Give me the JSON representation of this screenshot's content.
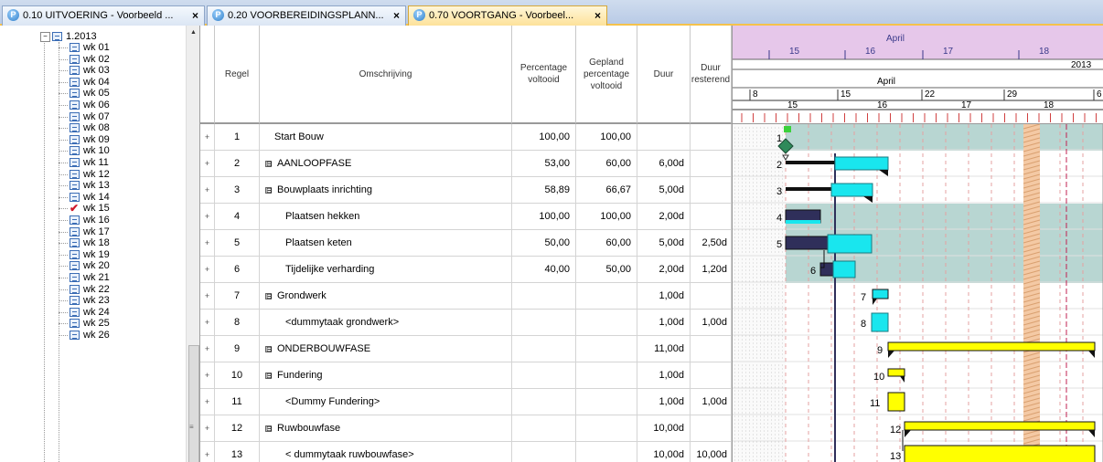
{
  "tabs": [
    {
      "label": "0.10 UITVOERING - Voorbeeld ...",
      "close": "×",
      "active": false
    },
    {
      "label": "0.20 VOORBEREIDINGSPLANN...",
      "close": "×",
      "active": false
    },
    {
      "label": "0.70 VOORTGANG - Voorbeel...",
      "close": "×",
      "active": true
    }
  ],
  "tree": {
    "root": "1.2013",
    "weeks": [
      "wk 01",
      "wk 02",
      "wk 03",
      "wk 04",
      "wk 05",
      "wk 06",
      "wk 07",
      "wk 08",
      "wk 09",
      "wk 10",
      "wk 11",
      "wk 12",
      "wk 13",
      "wk 14",
      "wk 15",
      "wk 16",
      "wk 17",
      "wk 18",
      "wk 19",
      "wk 20",
      "wk 21",
      "wk 22",
      "wk 23",
      "wk 24",
      "wk 25",
      "wk 26"
    ],
    "checked_week": "wk 15"
  },
  "columns": {
    "regel": "Regel",
    "omschrijving": "Omschrijving",
    "percentage": "Percentage voltooid",
    "gepland": "Gepland percentage voltooid",
    "duur": "Duur",
    "resterend": "Duur resterend"
  },
  "rows": [
    {
      "regel": "1",
      "oms": "Start Bouw",
      "indent": 1,
      "box": "",
      "pct": "100,00",
      "gep": "100,00",
      "duur": "",
      "rest": ""
    },
    {
      "regel": "2",
      "oms": "AANLOOPFASE",
      "indent": 0,
      "box": "⊟",
      "pct": "53,00",
      "gep": "60,00",
      "duur": "6,00d",
      "rest": ""
    },
    {
      "regel": "3",
      "oms": "Bouwplaats inrichting",
      "indent": 0,
      "box": "⊟",
      "pct": "58,89",
      "gep": "66,67",
      "duur": "5,00d",
      "rest": ""
    },
    {
      "regel": "4",
      "oms": "Plaatsen hekken",
      "indent": 2,
      "box": "",
      "pct": "100,00",
      "gep": "100,00",
      "duur": "2,00d",
      "rest": ""
    },
    {
      "regel": "5",
      "oms": "Plaatsen keten",
      "indent": 2,
      "box": "",
      "pct": "50,00",
      "gep": "60,00",
      "duur": "5,00d",
      "rest": "2,50d"
    },
    {
      "regel": "6",
      "oms": "Tijdelijke verharding",
      "indent": 2,
      "box": "",
      "pct": "40,00",
      "gep": "50,00",
      "duur": "2,00d",
      "rest": "1,20d"
    },
    {
      "regel": "7",
      "oms": "Grondwerk",
      "indent": 0,
      "box": "⊟",
      "pct": "",
      "gep": "",
      "duur": "1,00d",
      "rest": ""
    },
    {
      "regel": "8",
      "oms": "<dummytaak grondwerk>",
      "indent": 2,
      "box": "",
      "pct": "",
      "gep": "",
      "duur": "1,00d",
      "rest": "1,00d"
    },
    {
      "regel": "9",
      "oms": "ONDERBOUWFASE",
      "indent": 0,
      "box": "⊟",
      "pct": "",
      "gep": "",
      "duur": "11,00d",
      "rest": ""
    },
    {
      "regel": "10",
      "oms": "Fundering",
      "indent": 0,
      "box": "⊟",
      "pct": "",
      "gep": "",
      "duur": "1,00d",
      "rest": ""
    },
    {
      "regel": "11",
      "oms": "<Dummy Fundering>",
      "indent": 2,
      "box": "",
      "pct": "",
      "gep": "",
      "duur": "1,00d",
      "rest": "1,00d"
    },
    {
      "regel": "12",
      "oms": "Ruwbouwfase",
      "indent": 0,
      "box": "⊟",
      "pct": "",
      "gep": "",
      "duur": "10,00d",
      "rest": ""
    },
    {
      "regel": "13",
      "oms": "< dummytaak ruwbouwfase>",
      "indent": 2,
      "box": "",
      "pct": "",
      "gep": "",
      "duur": "10,00d",
      "rest": "10,00d"
    }
  ],
  "gantt": {
    "month_top": "April",
    "weeks_top": [
      "15",
      "16",
      "17",
      "18"
    ],
    "year": "2013",
    "month_mid": "April",
    "days": [
      "8",
      "15",
      "22",
      "29",
      "6"
    ],
    "weeks_bottom": [
      "15",
      "16",
      "17",
      "18"
    ],
    "colors": {
      "progress": "#2f2f5a",
      "remaining": "#19e6ee",
      "future": "#ffff00",
      "band": "#b8d6d2",
      "today": "#f4c9a4"
    }
  }
}
